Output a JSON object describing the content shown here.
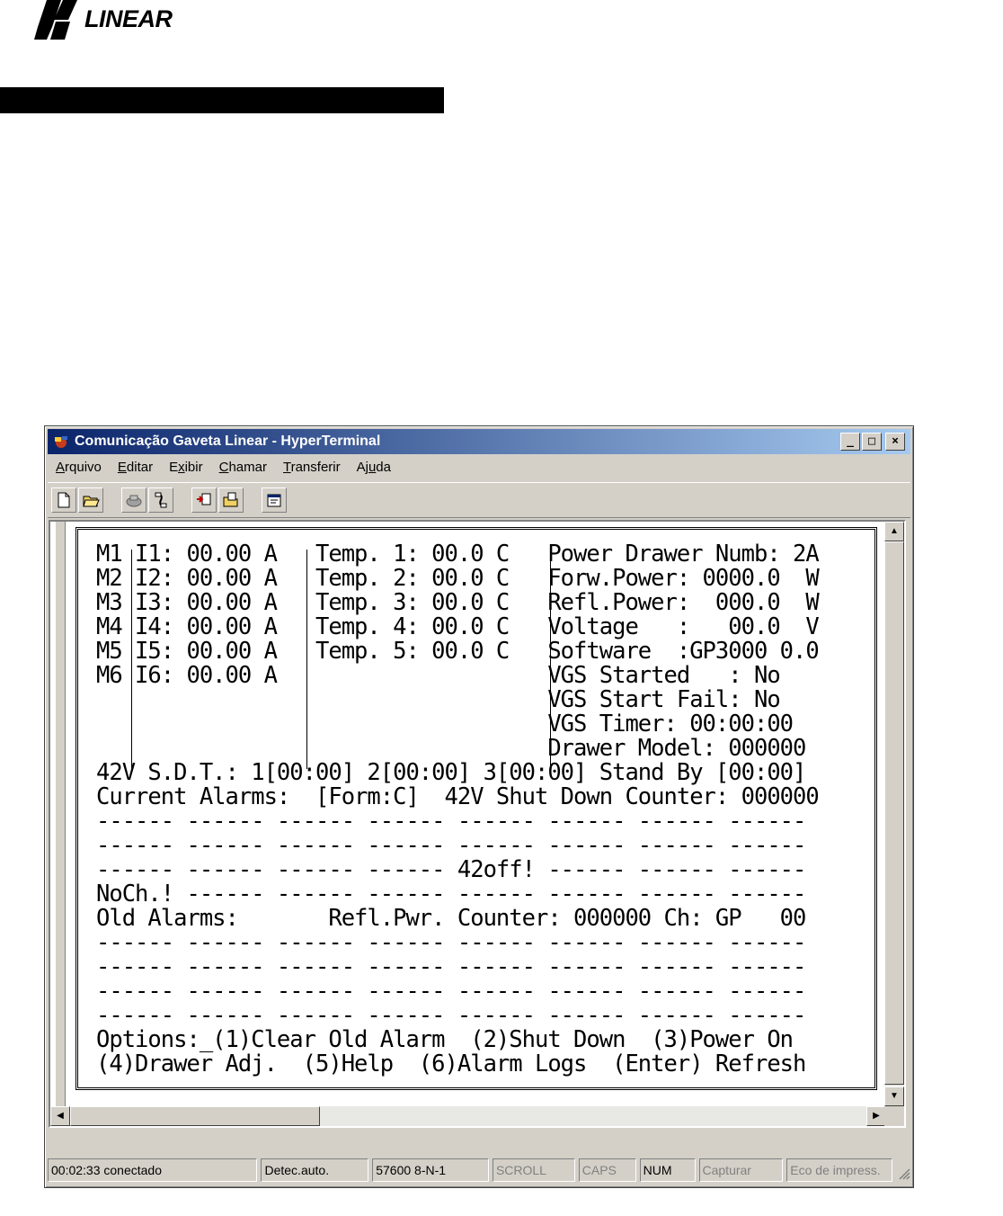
{
  "logo": {
    "text": "LINEAR"
  },
  "window": {
    "title": "Comunicação Gaveta Linear - HyperTerminal",
    "controls": {
      "minimize": "_",
      "maximize": "□",
      "close": "×"
    }
  },
  "menu": {
    "items": [
      {
        "underline": "A",
        "rest": "rquivo"
      },
      {
        "underline": "E",
        "rest": "ditar"
      },
      {
        "pre": "E",
        "underline": "x",
        "rest": "ibir"
      },
      {
        "underline": "C",
        "rest": "hamar"
      },
      {
        "underline": "T",
        "rest": "ransferir"
      },
      {
        "pre": "Aj",
        "underline": "u",
        "rest": "da"
      }
    ]
  },
  "toolbar": {
    "icons": [
      "new-file-icon",
      "open-folder-icon",
      "connect-icon",
      "disconnect-icon",
      "send-icon",
      "receive-icon",
      "properties-icon"
    ]
  },
  "terminal": {
    "lines": [
      "M1 I1: 00.00 A   Temp. 1: 00.0 C   Power Drawer Numb: 2A",
      "M2 I2: 00.00 A   Temp. 2: 00.0 C   Forw.Power: 0000.0  W",
      "M3 I3: 00.00 A   Temp. 3: 00.0 C   Refl.Power:  000.0  W",
      "M4 I4: 00.00 A   Temp. 4: 00.0 C   Voltage   :   00.0  V",
      "M5 I5: 00.00 A   Temp. 5: 00.0 C   Software  :GP3000 0.0",
      "M6 I6: 00.00 A                     VGS Started   : No",
      "                                   VGS Start Fail: No",
      "                                   VGS Timer: 00:00:00",
      "                                   Drawer Model: 000000",
      "42V S.D.T.: 1[00:00] 2[00:00] 3[00:00] Stand By [00:00]",
      "Current Alarms:  [Form:C]  42V Shut Down Counter: 000000",
      "------ ------ ------ ------ ------ ------ ------ ------",
      "------ ------ ------ ------ ------ ------ ------ ------",
      "------ ------ ------ ------ 42off! ------ ------ ------",
      "NoCh.! ------ ------ ------ ------ ------ ------ ------",
      "Old Alarms:       Refl.Pwr. Counter: 000000 Ch: GP   00",
      "------ ------ ------ ------ ------ ------ ------ ------",
      "------ ------ ------ ------ ------ ------ ------ ------",
      "------ ------ ------ ------ ------ ------ ------ ------",
      "------ ------ ------ ------ ------ ------ ------ ------",
      "Options:_(1)Clear Old Alarm  (2)Shut Down  (3)Power On",
      "(4)Drawer Adj.  (5)Help  (6)Alarm Logs  (Enter) Refresh"
    ]
  },
  "statusbar": {
    "time": "00:02:33 conectado",
    "detect": "Detec.auto.",
    "port": "57600 8-N-1",
    "scroll": "SCROLL",
    "caps": "CAPS",
    "num": "NUM",
    "capture": "Capturar",
    "print_echo": "Eco de impress."
  }
}
